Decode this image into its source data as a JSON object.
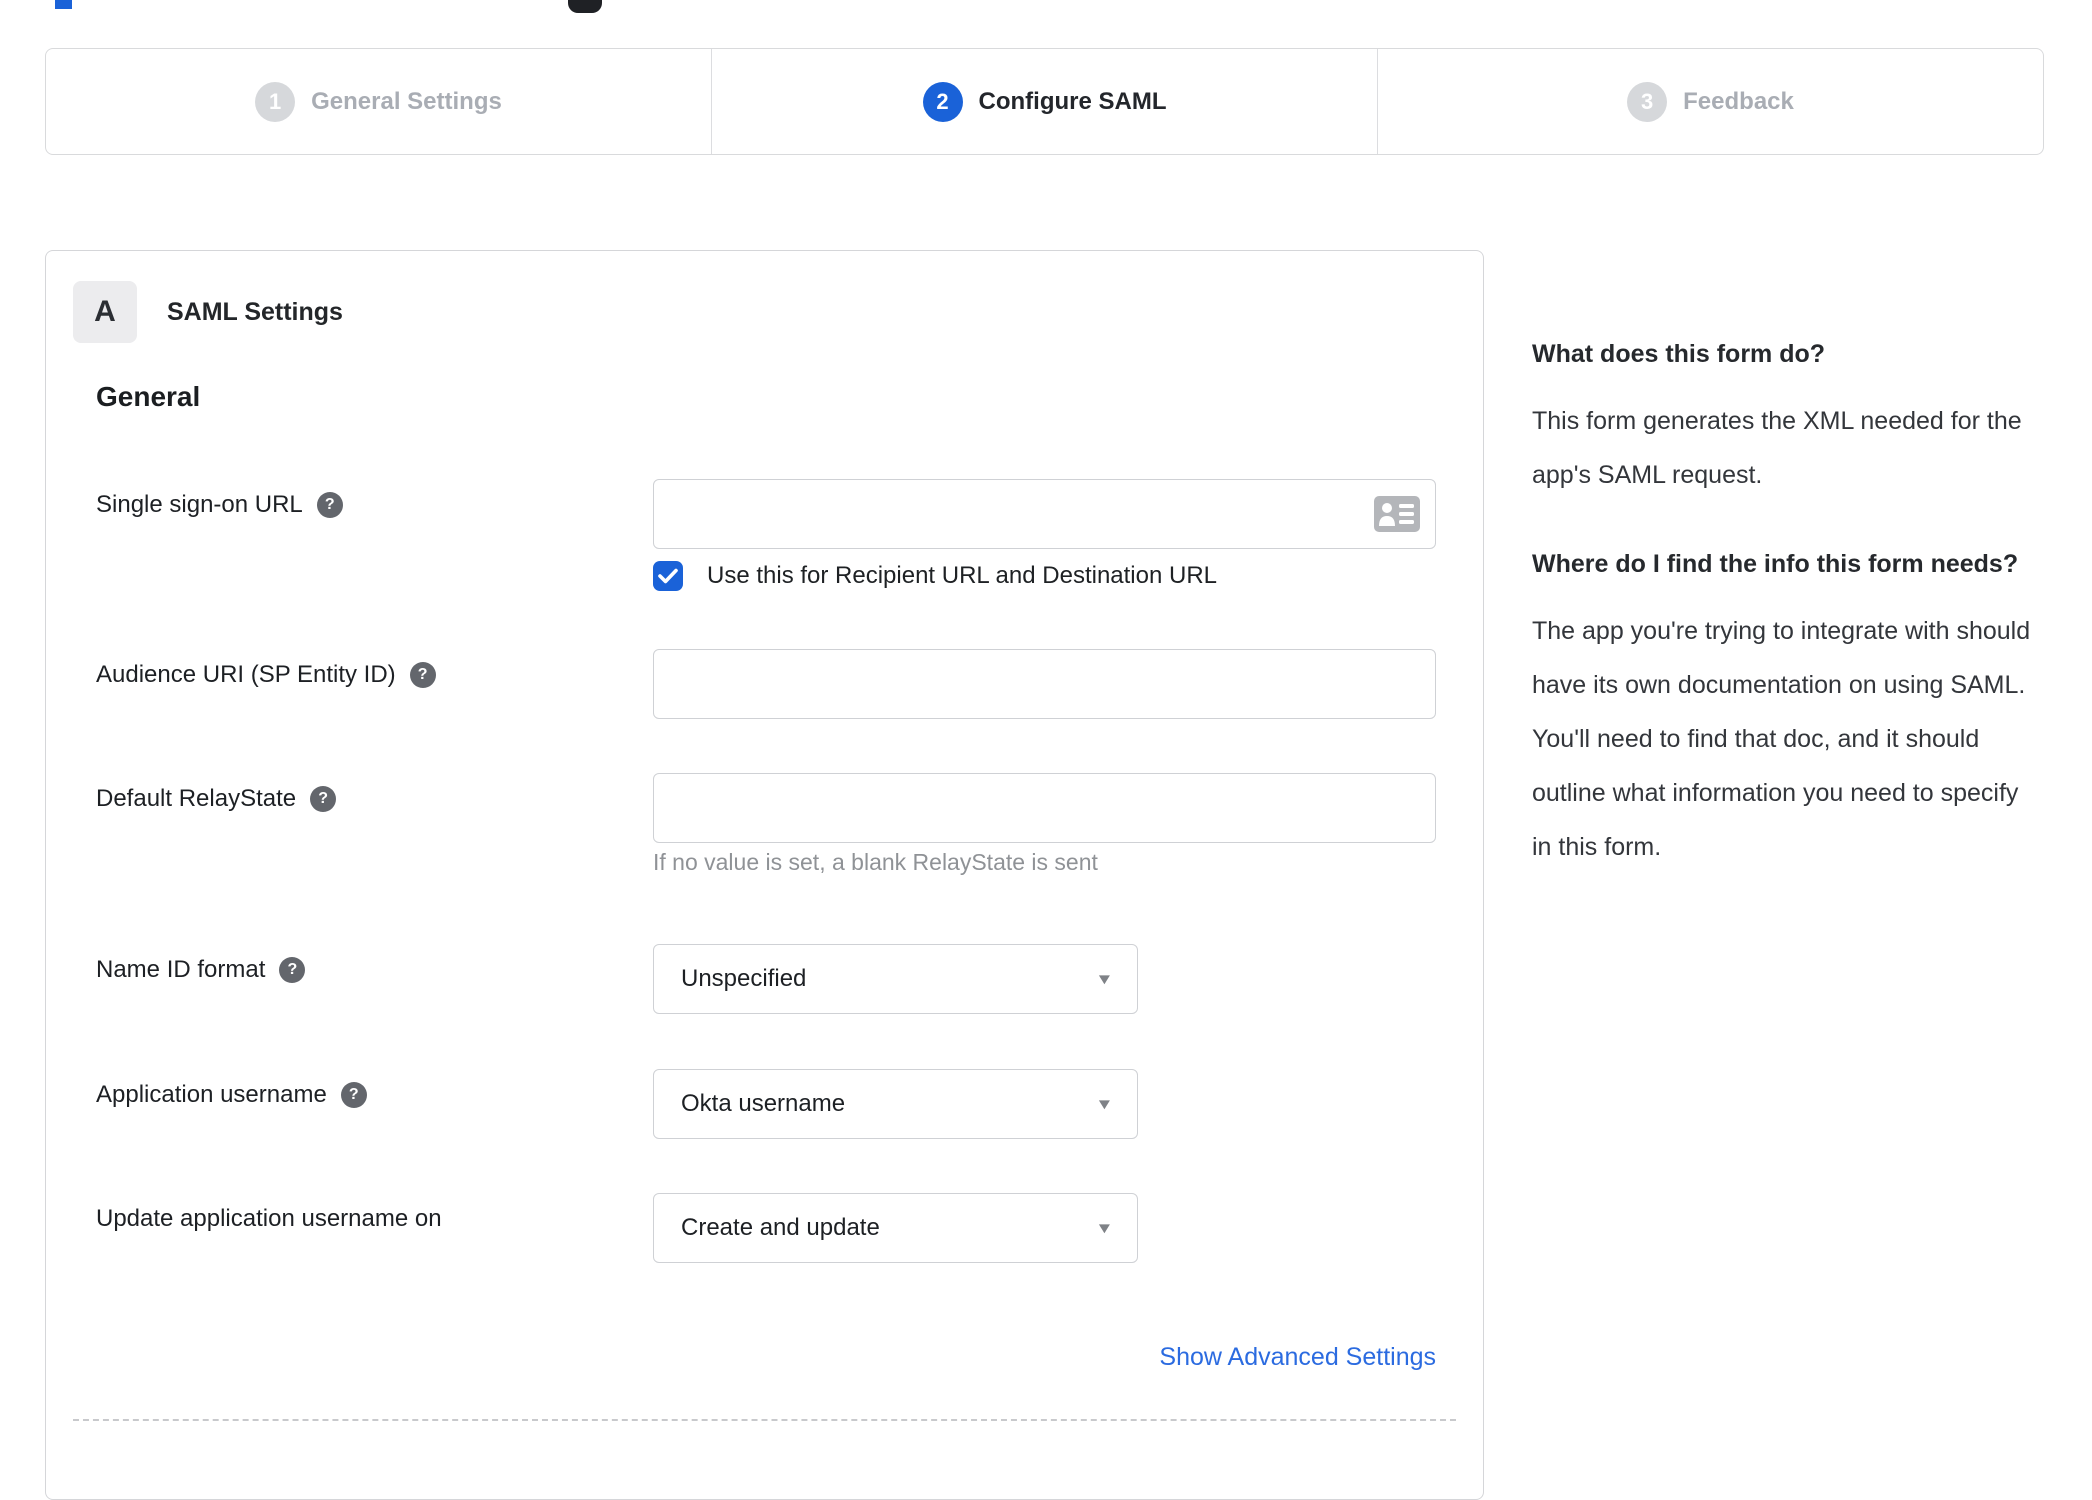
{
  "colors": {
    "accent_blue": "#1a62d8",
    "link_blue": "#2b6be0",
    "inactive_gray": "#d6d8db",
    "border_gray": "#d5d6d9"
  },
  "fragments": {
    "note": "cut-off page elements at top edge"
  },
  "stepper": {
    "steps": [
      {
        "number": "1",
        "label": "General Settings",
        "state": "inactive"
      },
      {
        "number": "2",
        "label": "Configure SAML",
        "state": "active"
      },
      {
        "number": "3",
        "label": "Feedback",
        "state": "inactive"
      }
    ]
  },
  "panel": {
    "section_badge": "A",
    "section_title": "SAML Settings",
    "group_heading": "General",
    "fields": [
      {
        "label": "Single sign-on URL",
        "has_help": true,
        "type": "text",
        "value": "",
        "checkbox_label": "Use this for Recipient URL and Destination URL",
        "checkbox_checked": true
      },
      {
        "label": "Audience URI (SP Entity ID)",
        "has_help": true,
        "type": "text",
        "value": ""
      },
      {
        "label": "Default RelayState",
        "has_help": true,
        "type": "text",
        "value": "",
        "hint": "If no value is set, a blank RelayState is sent"
      },
      {
        "label": "Name ID format",
        "has_help": true,
        "type": "select",
        "value": "Unspecified"
      },
      {
        "label": "Application username",
        "has_help": true,
        "type": "select",
        "value": "Okta username"
      },
      {
        "label": "Update application username on",
        "has_help": false,
        "type": "select",
        "value": "Create and update"
      }
    ],
    "advanced_link": "Show Advanced Settings"
  },
  "sidebar": {
    "sections": [
      {
        "heading": "What does this form do?",
        "body": "This form generates the XML needed for the app's SAML request."
      },
      {
        "heading": "Where do I find the info this form needs?",
        "body": "The app you're trying to integrate with should have its own documentation on using SAML. You'll need to find that doc, and it should outline what information you need to specify in this form."
      }
    ]
  },
  "icons": {
    "help": "?",
    "dropdown_caret": "▼",
    "sso_field_icon": "contact-card"
  }
}
